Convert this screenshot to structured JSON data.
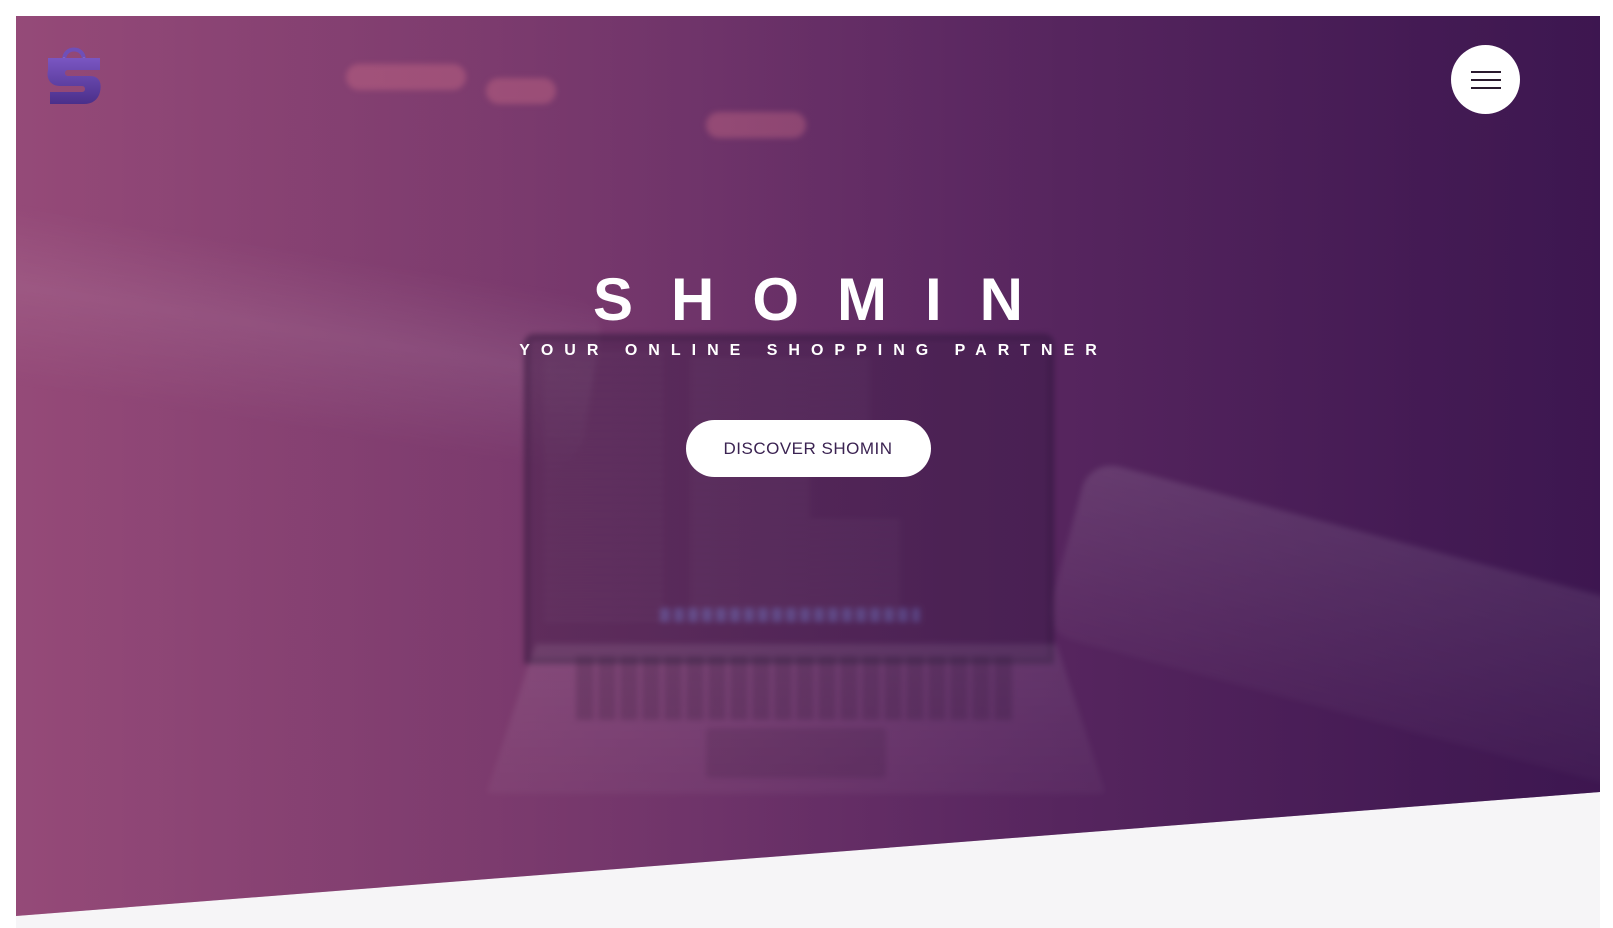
{
  "header": {
    "logo_icon": "shopping-bag-s-logo-icon",
    "menu_icon": "hamburger-menu-icon"
  },
  "hero": {
    "title": "SHOMIN",
    "tagline": "YOUR ONLINE SHOPPING PARTNER",
    "cta_label": "DISCOVER SHOMIN"
  },
  "colors": {
    "gradient_start": "#944c78",
    "gradient_end": "#3e1750",
    "logo_purple": "#5b3b9e",
    "button_text": "#3b2352",
    "section_background": "#f6f5f7"
  }
}
